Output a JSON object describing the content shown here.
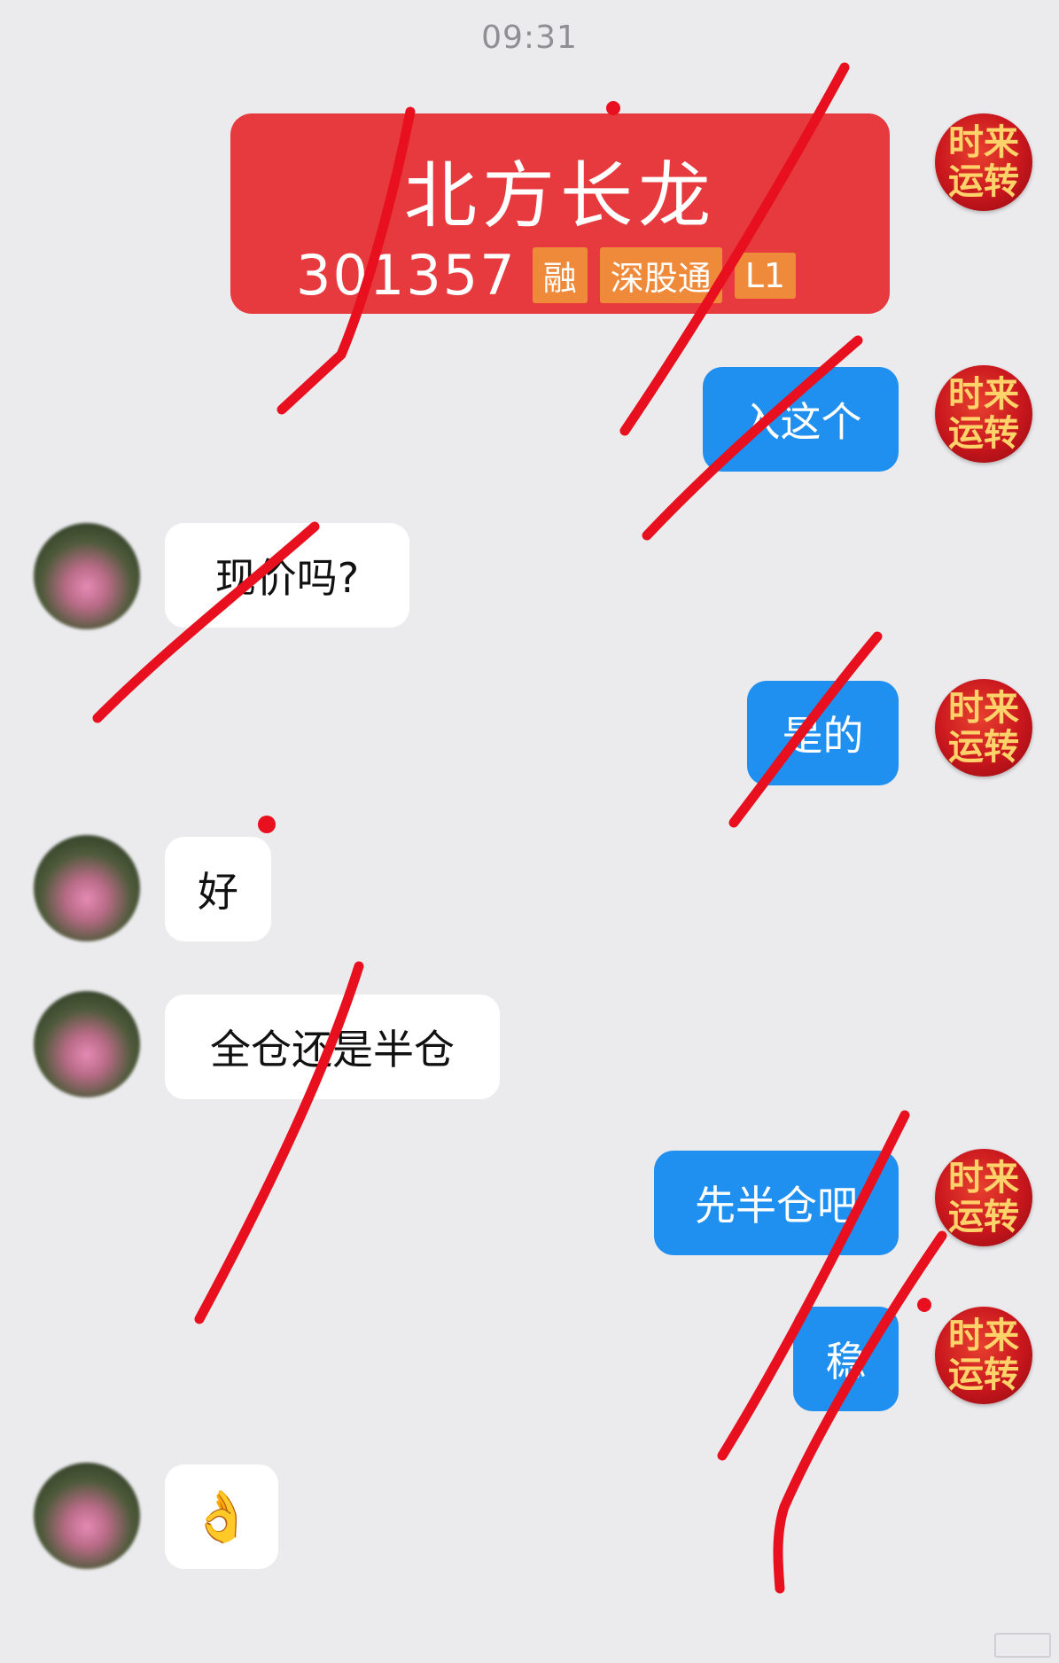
{
  "status": {
    "time": "09:31"
  },
  "contact_avatar": {
    "line1": "时来",
    "line2": "运转"
  },
  "stock_card": {
    "name": "北方长龙",
    "code": "301357",
    "tags": [
      "融",
      "深股通",
      "L1"
    ]
  },
  "messages": [
    {
      "side": "right",
      "text": "入这个"
    },
    {
      "side": "left",
      "text": "现价吗?"
    },
    {
      "side": "right",
      "text": "是的"
    },
    {
      "side": "left",
      "text": "好"
    },
    {
      "side": "left",
      "text": "全仓还是半仓"
    },
    {
      "side": "right",
      "text": "先半仓吧"
    },
    {
      "side": "right",
      "text": "稳"
    },
    {
      "side": "left",
      "text": "👌"
    }
  ],
  "colors": {
    "background": "#ebebee",
    "sent_bubble": "#1f8ff0",
    "received_bubble": "#ffffff",
    "stock_card": "#e63a3e",
    "tag": "#f08a3b",
    "annotation_strokes": "#e8101e"
  }
}
